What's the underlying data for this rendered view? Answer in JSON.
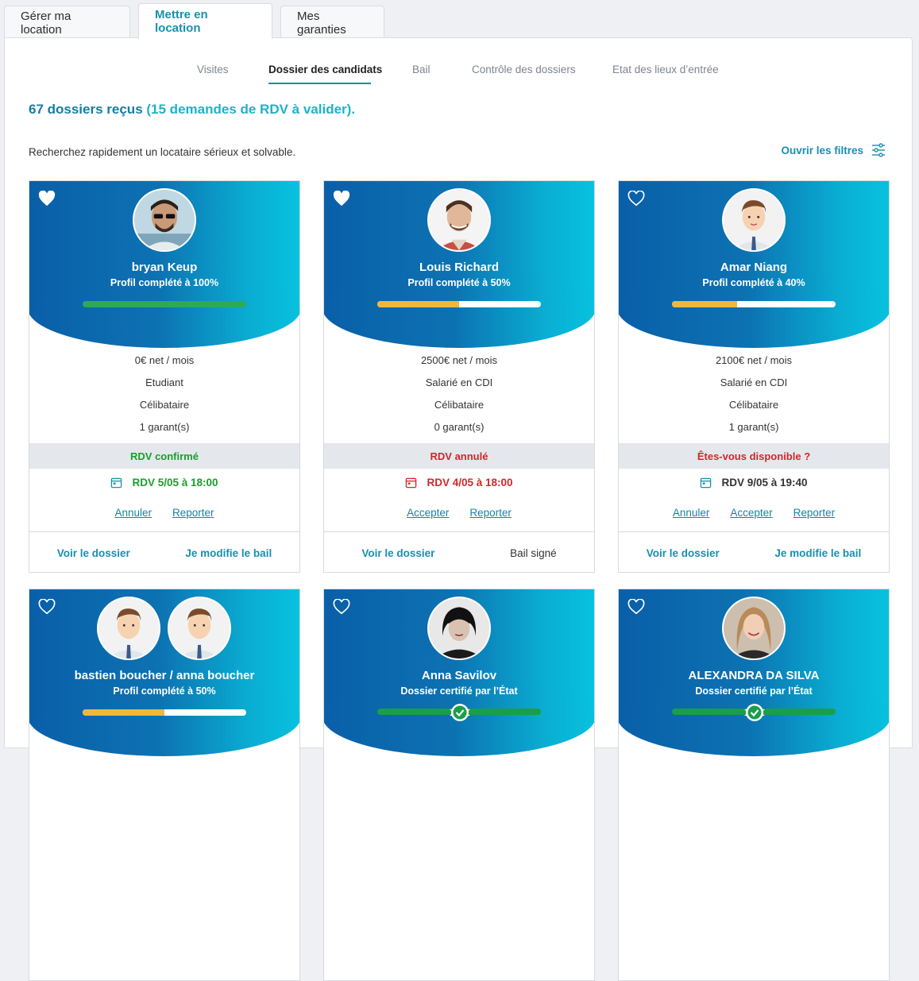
{
  "tabs": [
    {
      "label": "Gérer ma location",
      "active": false
    },
    {
      "label": "Mettre en location",
      "active": true
    },
    {
      "label": "Mes garanties",
      "active": false
    }
  ],
  "subnav": [
    "Visites",
    "Dossier des candidats",
    "Bail",
    "Contrôle des dossiers",
    "Etat des lieux d’entrée"
  ],
  "headline": {
    "part1": "67 dossiers reçus",
    "part2": "(15 demandes de RDV à valider)."
  },
  "intro": "Recherchez rapidement un locataire sérieux et solvable.",
  "filters_label": "Ouvrir les filtres",
  "colors": {
    "accent": "#178fb2",
    "green": "#1a9e4a",
    "red": "#d3262a",
    "yellow": "#f0b83a"
  },
  "cards": [
    {
      "name": "bryan Keup",
      "subtitle": "Profil complété à 100%",
      "progress": 1.0,
      "progress_color": "#2eaa54",
      "favorite": true,
      "income": "0€ net / mois",
      "job": "Etudiant",
      "status_family": "Célibataire",
      "guarantors": "1 garant(s)",
      "rdv_status": "RDV confirmé",
      "rdv_status_color": "#1a9e2a",
      "rdv_date": "RDV 5/05 à 18:00",
      "rdv_color": "#1a9e2a",
      "actions": [
        "Annuler",
        "Reporter"
      ],
      "footer_left": "Voir le dossier",
      "footer_right": "Je modifie le bail"
    },
    {
      "name": "Louis Richard",
      "subtitle": "Profil complété à 50%",
      "progress": 0.5,
      "progress_color": "#f0b83a",
      "favorite": true,
      "income": "2500€ net / mois",
      "job": "Salarié en CDI",
      "status_family": "Célibataire",
      "guarantors": "0 garant(s)",
      "rdv_status": "RDV annulé",
      "rdv_status_color": "#d3262a",
      "rdv_date": "RDV 4/05 à 18:00",
      "rdv_color": "#d3262a",
      "actions": [
        "Accepter",
        "Reporter"
      ],
      "footer_left": "Voir le dossier",
      "footer_right": "Bail signé"
    },
    {
      "name": "Amar Niang",
      "subtitle": "Profil complété à 40%",
      "progress": 0.4,
      "progress_color": "#f0b83a",
      "favorite": false,
      "income": "2100€ net / mois",
      "job": "Salarié en CDI",
      "status_family": "Célibataire",
      "guarantors": "1 garant(s)",
      "rdv_status": "Êtes-vous disponible ?",
      "rdv_status_color": "#d3262a",
      "rdv_date": "RDV 9/05 à 19:40",
      "rdv_color": "#333333",
      "actions": [
        "Annuler",
        "Accepter",
        "Reporter"
      ],
      "footer_left": "Voir le dossier",
      "footer_right": "Je modifie le bail"
    },
    {
      "name": "bastien boucher / anna boucher",
      "subtitle": "Profil complété à 50%",
      "progress": 0.5,
      "progress_color": "#f0b83a",
      "favorite": false
    },
    {
      "name": "Anna Savilov",
      "subtitle": "Dossier certifié par l’État",
      "certified": true,
      "favorite": false
    },
    {
      "name": "ALEXANDRA DA SILVA",
      "subtitle": "Dossier certifié par l’État",
      "certified": true,
      "favorite": false
    }
  ]
}
